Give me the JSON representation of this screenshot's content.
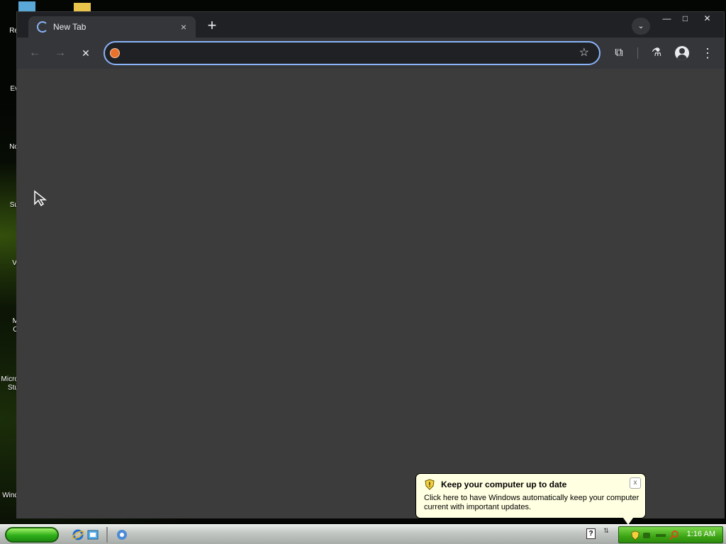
{
  "desktop": {
    "icon_labels": [
      "Re",
      "Ev",
      "No",
      "Su",
      "Vi",
      "M",
      "O",
      "Micro",
      "Stu",
      "Wind"
    ]
  },
  "browser": {
    "tab_title": "New Tab",
    "tab_close": "×",
    "new_tab": "+",
    "tab_search": "⌄",
    "window_controls": {
      "minimize": "—",
      "maximize": "□",
      "close": "✕"
    },
    "nav": {
      "back": "←",
      "forward": "→",
      "stop": "✕"
    },
    "omnibox": {
      "value": "",
      "bookmark": "☆"
    },
    "extensions": "⧉",
    "labs": "⚗",
    "menu": "⋮"
  },
  "balloon": {
    "title": "Keep your computer up to date",
    "body": "Click here to have Windows automatically keep your computer current with important updates.",
    "close": "x"
  },
  "taskbar": {
    "help": "?",
    "clock": "1:16 AM"
  },
  "colors": {
    "accent": "#8ab4f8",
    "content_bg": "#3c3c3c",
    "balloon_bg": "#ffffe1",
    "tray_green": "#3da515"
  }
}
